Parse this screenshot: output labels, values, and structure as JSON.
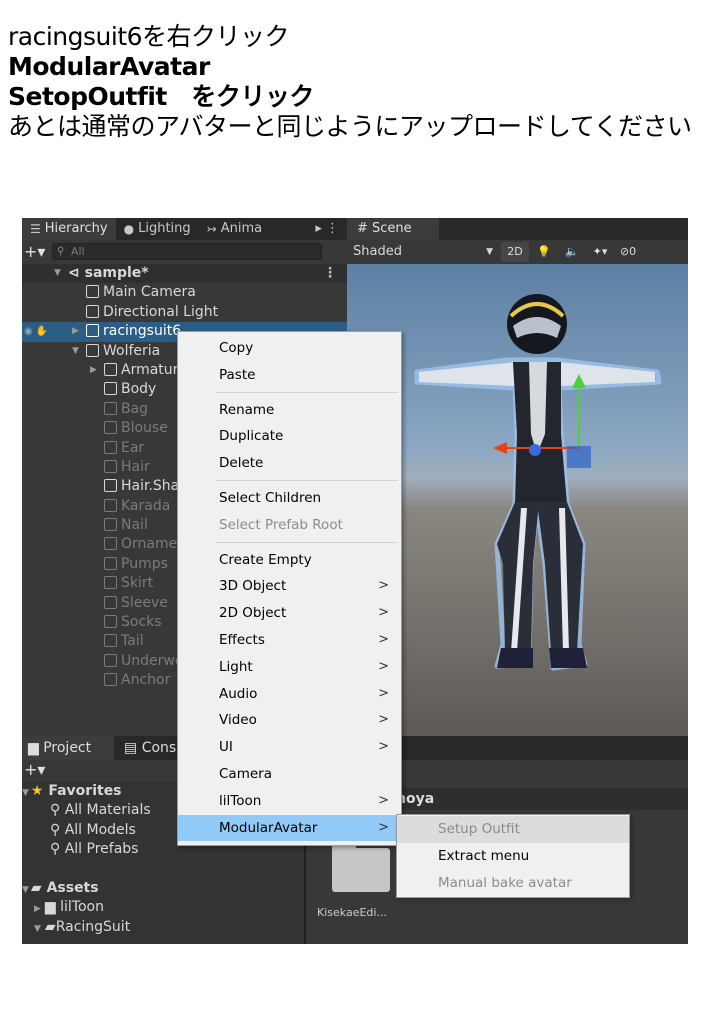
{
  "instructions": {
    "line1": "racingsuit6を右クリック",
    "line2": "ModularAvatar",
    "line3": "SetopOutfit　をクリック",
    "line4": "あとは通常のアバターと同じようにアップロードしてください"
  },
  "hierarchy": {
    "tabs": [
      {
        "icon": "☰",
        "label": "Hierarchy"
      },
      {
        "icon": "●",
        "label": "Lighting"
      },
      {
        "icon": "↣",
        "label": "Anima"
      }
    ],
    "tab_more": "▸ ⋮",
    "add_button": "+▾",
    "search_placeholder": "All",
    "scene_name": "sample*",
    "rows": [
      {
        "label": "Main Camera"
      },
      {
        "label": "Directional Light"
      },
      {
        "label": "racingsuit6"
      },
      {
        "label": "Wolferia"
      },
      {
        "label": "Armature"
      },
      {
        "label": "Body"
      },
      {
        "label": "Bag"
      },
      {
        "label": "Blouse"
      },
      {
        "label": "Ear"
      },
      {
        "label": "Hair"
      },
      {
        "label": "Hair.Sha"
      },
      {
        "label": "Karada"
      },
      {
        "label": "Nail"
      },
      {
        "label": "Ornament"
      },
      {
        "label": "Pumps"
      },
      {
        "label": "Skirt"
      },
      {
        "label": "Sleeve"
      },
      {
        "label": "Socks"
      },
      {
        "label": "Tail"
      },
      {
        "label": "Underwear"
      },
      {
        "label": "Anchor"
      }
    ]
  },
  "scene": {
    "tab": "# Scene",
    "shading_mode": "Shaded",
    "btn_2d": "2D",
    "toolbar_icons": [
      "light-bulb-icon",
      "audio-icon",
      "effects-icon",
      "hidden-icon"
    ],
    "hidden_count": "0"
  },
  "bottom": {
    "tabs": [
      "Project",
      "Console"
    ],
    "add_button": "+▾",
    "favorites_label": "Favorites",
    "favorites": [
      "All Materials",
      "All Models",
      "All Prefabs"
    ],
    "assets_label": "Assets",
    "assets": [
      "lilToon",
      "RacingSuit"
    ],
    "breadcrumb": "noya",
    "folder_label": "KisekaeEdi..."
  },
  "context_menu": {
    "groups": [
      [
        {
          "label": "Copy"
        },
        {
          "label": "Paste"
        }
      ],
      [
        {
          "label": "Rename"
        },
        {
          "label": "Duplicate"
        },
        {
          "label": "Delete"
        }
      ],
      [
        {
          "label": "Select Children"
        },
        {
          "label": "Select Prefab Root",
          "disabled": true
        }
      ],
      [
        {
          "label": "Create Empty"
        },
        {
          "label": "3D Object",
          "submenu": true
        },
        {
          "label": "2D Object",
          "submenu": true
        },
        {
          "label": "Effects",
          "submenu": true
        },
        {
          "label": "Light",
          "submenu": true
        },
        {
          "label": "Audio",
          "submenu": true
        },
        {
          "label": "Video",
          "submenu": true
        },
        {
          "label": "UI",
          "submenu": true
        },
        {
          "label": "Camera"
        },
        {
          "label": "lilToon",
          "submenu": true
        },
        {
          "label": "ModularAvatar",
          "submenu": true,
          "highlighted": true
        }
      ]
    ],
    "submenu_arrow": ">"
  },
  "modular_avatar_submenu": [
    {
      "label": "Setup Outfit",
      "hover": true
    },
    {
      "label": "Extract menu"
    },
    {
      "label": "Manual bake avatar",
      "disabled": true
    }
  ],
  "colors": {
    "menu_highlight": "#91c9f7",
    "selected_row": "#2c5d87",
    "editor_bg": "#383838"
  }
}
